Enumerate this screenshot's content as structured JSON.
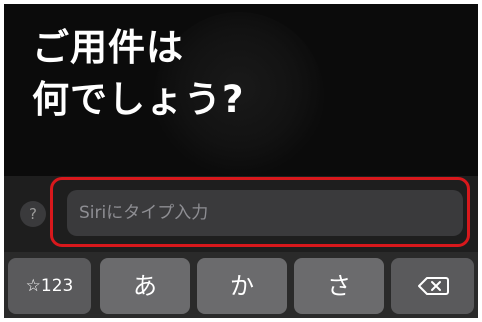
{
  "siri": {
    "prompt_line1": "ご用件は",
    "prompt_line2": "何でしょう?"
  },
  "input": {
    "help_label": "?",
    "placeholder": "Siriにタイプ入力"
  },
  "keyboard": {
    "keys": [
      {
        "label": "☆123"
      },
      {
        "label": "あ"
      },
      {
        "label": "か"
      },
      {
        "label": "さ"
      }
    ],
    "delete_icon": "delete-backward-icon"
  },
  "colors": {
    "background": "#0b0b0b",
    "highlight": "#d8181c",
    "field": "#3a3a3c",
    "key": "#6b6b6d"
  }
}
